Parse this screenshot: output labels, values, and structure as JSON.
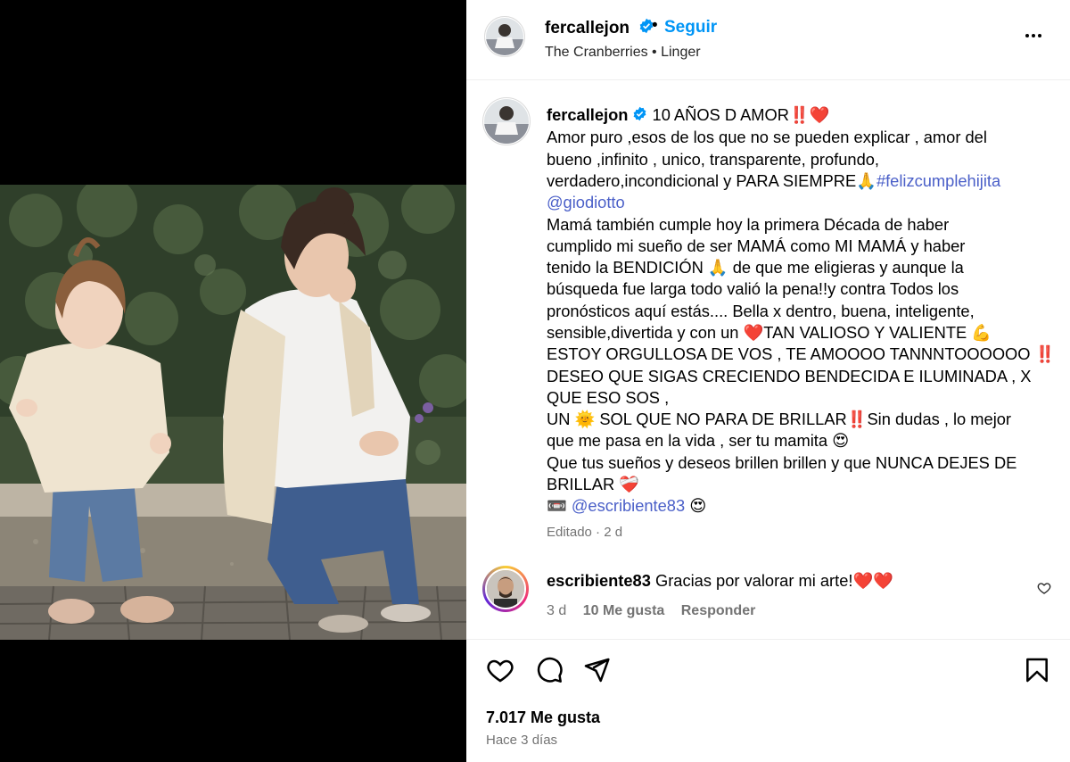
{
  "post": {
    "username": "fercallejon",
    "follow_label": "Seguir",
    "separator": "•",
    "music": "The Cranberries • Linger"
  },
  "caption": {
    "username": "fercallejon",
    "lines": [
      " 10 AÑOS D AMOR‼️❤️",
      "Amor puro ,esos de los que no se pueden explicar , amor del",
      "bueno ,infinito , unico, transparente, profundo,",
      "verdadero,incondicional y PARA SIEMPRE🙏",
      "",
      "Mamá también cumple hoy la primera Década de haber",
      "cumplido mi sueño de ser MAMÁ como MI MAMÁ y haber",
      "tenido la BENDICIÓN 🙏 de que me eligieras y aunque la",
      "búsqueda fue larga todo valió la pena!!y contra Todos los",
      "pronósticos aquí estás.... Bella x dentro, buena, inteligente,",
      "sensible,divertida y con un ❤️TAN VALIOSO Y VALIENTE 💪",
      "ESTOY ORGULLOSA DE VOS , TE AMOOOO TANNNTOOOOOO ‼️",
      "DESEO QUE SIGAS CRECIENDO BENDECIDA E ILUMINADA , X",
      "QUE ESO SOS ,",
      "UN 🌞 SOL QUE NO PARA DE BRILLAR‼️Sin dudas , lo mejor",
      "que me pasa en la vida , ser tu mamita 😍",
      "Que tus sueños y deseos brillen brillen y que NUNCA DEJES DE",
      "BRILLAR ❤️‍🩹",
      "📼 ",
      ""
    ],
    "hashtag": "#felizcumplehijita",
    "mention_1": "@giodiotto",
    "mention_2": "@escribiente83",
    "mention_2_suffix": " 😍",
    "edited": "Editado · 2 d"
  },
  "comment": {
    "username": "escribiente83",
    "text": "Gracias por valorar mi arte!❤️❤️",
    "time": "3 d",
    "likes": "10 Me gusta",
    "reply": "Responder"
  },
  "footer": {
    "likes": "7.017 Me gusta",
    "time_ago": "Hace 3 días"
  },
  "colors": {
    "link_blue": "#0095f6",
    "tag_blue": "#4a5fc8",
    "secondary_text": "#737373"
  }
}
